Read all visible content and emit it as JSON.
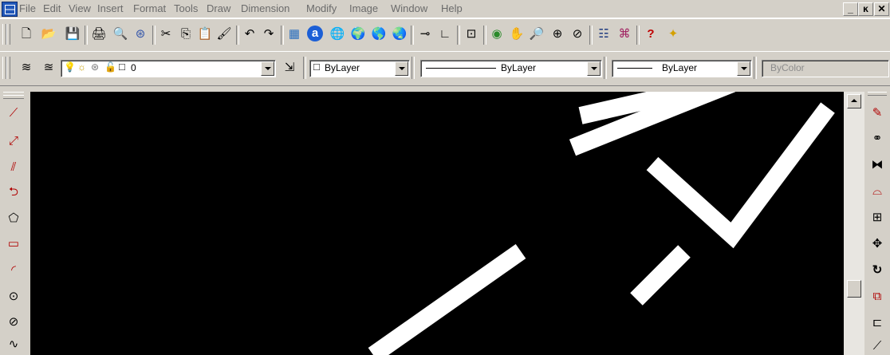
{
  "menu": {
    "items": [
      "File",
      "Edit",
      "View",
      "Insert",
      "Format",
      "Tools",
      "Draw",
      "Dimension",
      "Modify",
      "Image",
      "Window",
      "Help"
    ]
  },
  "window_controls": {
    "minimize": "_",
    "restore": "ĸ",
    "close": "✕"
  },
  "layer_toolbar": {
    "layer_value": "0",
    "color_value": "ByLayer",
    "linetype_value": "ByLayer",
    "lineweight_value": "ByLayer",
    "plotstyle_value": "ByColor"
  },
  "colors": {
    "canvas": "#000000",
    "chrome": "#d4d0c8",
    "disabled_text": "#6b6b6b"
  }
}
